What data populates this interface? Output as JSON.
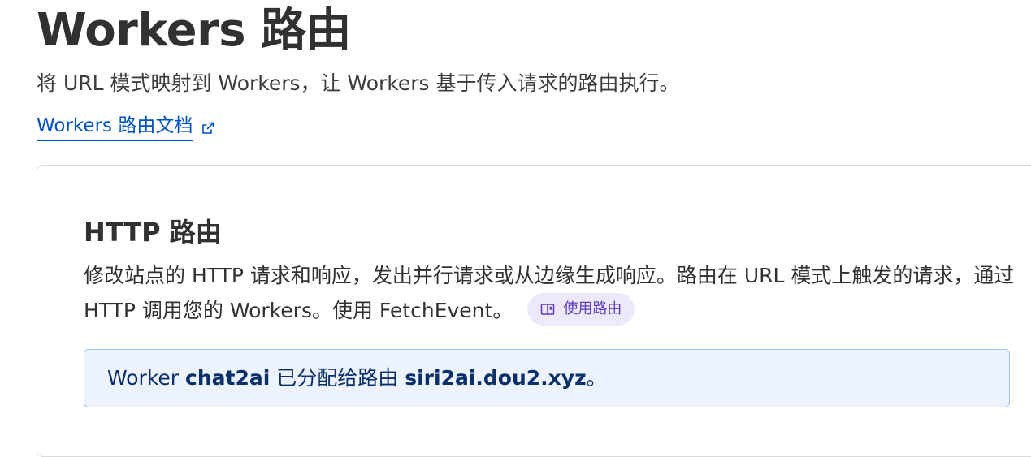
{
  "header": {
    "title": "Workers 路由",
    "description": "将 URL 模式映射到 Workers，让 Workers 基于传入请求的路由执行。",
    "doc_link_label": "Workers 路由文档",
    "doc_link_icon": "external-link-icon"
  },
  "http_routes": {
    "title": "HTTP 路由",
    "description": "修改站点的 HTTP 请求和响应，发出并行请求或从边缘生成响应。路由在 URL 模式上触发的请求，通过 HTTP 调用您的 Workers。使用 FetchEvent。",
    "usage_button_label": "使用路由",
    "usage_button_icon": "book-icon",
    "info": {
      "prefix": "Worker ",
      "worker_name": "chat2ai",
      "middle": " 已分配给路由 ",
      "route": "siri2ai.dou2.xyz",
      "suffix": "。"
    }
  },
  "colors": {
    "link": "#0051c3",
    "pill_bg": "#ede9fb",
    "pill_text": "#5a3fc0",
    "info_bg": "#ecf3fe",
    "info_border": "#9ec4f5",
    "info_text": "#0a2f6b"
  }
}
